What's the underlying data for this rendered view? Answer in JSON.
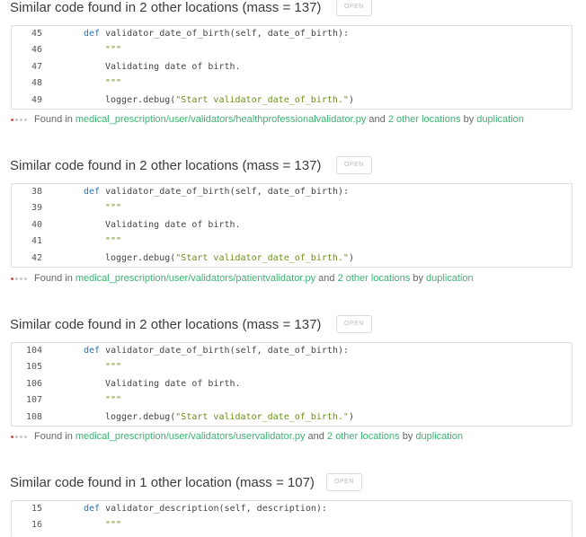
{
  "issues": [
    {
      "title": "Similar code found in 2 other locations (mass = 137)",
      "open_label": "OPEN",
      "lines": [
        {
          "num": "45",
          "code": "def validator_date_of_birth(self, date_of_birth):"
        },
        {
          "num": "46",
          "code": "\"\"\""
        },
        {
          "num": "47",
          "code": "Validating date of birth."
        },
        {
          "num": "48",
          "code": "\"\"\""
        },
        {
          "num": "49",
          "code": "logger.debug(\"Start validator_date_of_birth.\")"
        }
      ],
      "found_prefix": "Found in",
      "path": "medical_prescription/user/validators/healthprofessionalvalidator.py",
      "and_text": "and",
      "other_locations": "2 other locations",
      "by_text": "by",
      "category": "duplication"
    },
    {
      "title": "Similar code found in 2 other locations (mass = 137)",
      "open_label": "OPEN",
      "lines": [
        {
          "num": "38",
          "code": "def validator_date_of_birth(self, date_of_birth):"
        },
        {
          "num": "39",
          "code": "\"\"\""
        },
        {
          "num": "40",
          "code": "Validating date of birth."
        },
        {
          "num": "41",
          "code": "\"\"\""
        },
        {
          "num": "42",
          "code": "logger.debug(\"Start validator_date_of_birth.\")"
        }
      ],
      "found_prefix": "Found in",
      "path": "medical_prescription/user/validators/patientvalidator.py",
      "and_text": "and",
      "other_locations": "2 other locations",
      "by_text": "by",
      "category": "duplication"
    },
    {
      "title": "Similar code found in 2 other locations (mass = 137)",
      "open_label": "OPEN",
      "lines": [
        {
          "num": "104",
          "code": "def validator_date_of_birth(self, date_of_birth):"
        },
        {
          "num": "105",
          "code": "\"\"\""
        },
        {
          "num": "106",
          "code": "Validating date of birth."
        },
        {
          "num": "107",
          "code": "\"\"\""
        },
        {
          "num": "108",
          "code": "logger.debug(\"Start validator_date_of_birth.\")"
        }
      ],
      "found_prefix": "Found in",
      "path": "medical_prescription/user/validators/uservalidator.py",
      "and_text": "and",
      "other_locations": "2 other locations",
      "by_text": "by",
      "category": "duplication"
    },
    {
      "title": "Similar code found in 1 other location (mass = 107)",
      "open_label": "OPEN",
      "lines": [
        {
          "num": "15",
          "code": "def validator_description(self, description):"
        },
        {
          "num": "16",
          "code": "\"\"\""
        }
      ]
    }
  ]
}
